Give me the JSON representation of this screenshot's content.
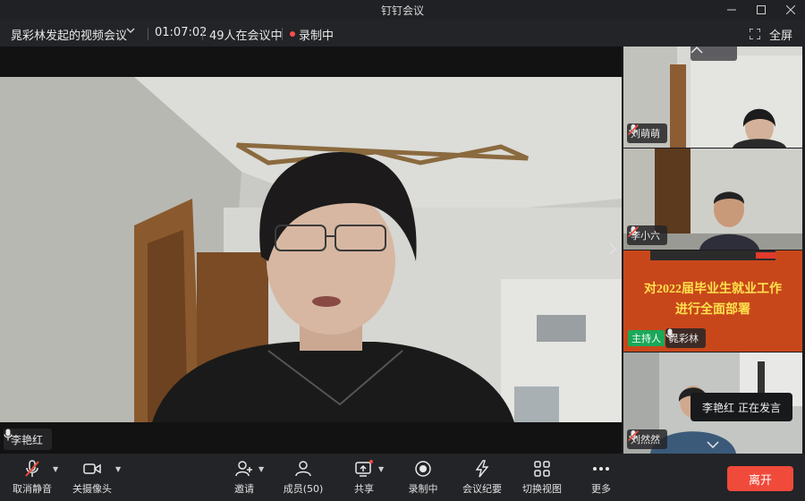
{
  "window": {
    "title": "钉钉会议"
  },
  "infobar": {
    "meeting_name": "晁彩林发起的视频会议",
    "timer": "01:07:02",
    "participants_status": "49人在会议中",
    "recording_status": "录制中",
    "fullscreen_label": "全屏"
  },
  "main_video": {
    "speaker_name": "李艳红"
  },
  "tiles": [
    {
      "name": "刘萌萌",
      "muted": true
    },
    {
      "name": "李小六",
      "muted": true
    },
    {
      "name": "晁彩林",
      "host_label": "主持人",
      "muted": false,
      "slide_text_line1": "对2022届毕业生就业工作",
      "slide_text_line2": "进行全面部署"
    },
    {
      "name": "刘然然",
      "muted": true
    }
  ],
  "speaking_indicator": {
    "name": "李艳红",
    "status": "正在发言"
  },
  "toolbar": {
    "unmute": "取消静音",
    "camera": "关摄像头",
    "invite": "邀请",
    "members": "成员(50)",
    "share": "共享",
    "recording": "录制中",
    "minutes": "会议纪要",
    "switch_view": "切换视图",
    "more": "更多",
    "leave": "离开"
  },
  "colors": {
    "leave": "#f04a3b",
    "host_badge": "#1aa85a",
    "slide_bg": "#c8471a",
    "slide_text": "#ffe14d",
    "rec_dot": "#ff4d4f"
  }
}
